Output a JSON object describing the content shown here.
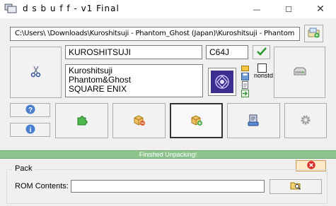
{
  "window": {
    "title": "d s b u f f - v1 Final",
    "minimize": "—",
    "maximize": "☐",
    "close": "✕"
  },
  "rom_path": "C:\\Users\\          \\Downloads\\Kuroshitsuji - Phantom_Ghost (Japan)\\Kuroshitsuji - Phantom",
  "game": {
    "title": "KUROSHITSUJI",
    "code": "C64J",
    "description_lines": [
      "Kuroshitsuji",
      "Phantom&Ghost",
      "SQUARE ENIX"
    ]
  },
  "nonstd_label": "nonstd",
  "status": {
    "text": "Finished Unpacking!"
  },
  "pack": {
    "label": "Pack",
    "rom_contents_label": "ROM Contents:",
    "rom_contents_value": ""
  },
  "icons": {
    "app": "ds-console-icon",
    "browse_rom": "folder-cube-icon",
    "cut": "scissors-icon",
    "confirm": "checkmark-icon",
    "banner": "game-banner-icon",
    "drive": "drive-icon",
    "help": "help-icon",
    "info": "info-icon",
    "plugin": "puzzle-icon",
    "unpack": "box-remove-icon",
    "pack": "box-add-icon",
    "disk": "disk-write-icon",
    "settings": "gear-icon",
    "close": "red-x-icon",
    "browse": "folder-search-icon"
  },
  "colors": {
    "status_bar": "#8dc38d",
    "close_red": "#d92b2b",
    "check_green": "#2e9a2e",
    "banner_purple": "#3b2f8f"
  }
}
